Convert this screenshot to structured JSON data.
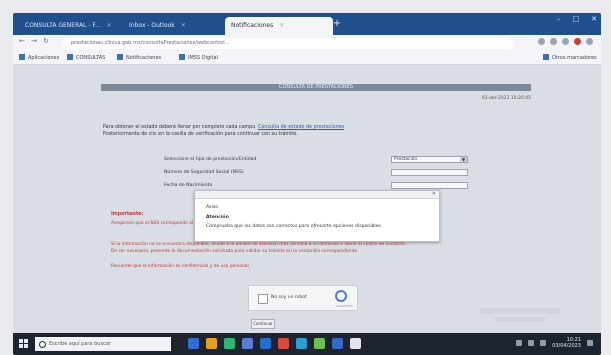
{
  "browser": {
    "tabs": [
      {
        "label": "CONSULTA GENERAL - F..."
      },
      {
        "label": "Inbox - Outlook"
      },
      {
        "label": "Notificaciones"
      }
    ],
    "new_tab": "+",
    "window_controls": [
      "–",
      "□",
      "✕"
    ],
    "address": "prestaciones.clinica.gob.mx/consultaPrestaciones/webcontrol...",
    "bookmarks": [
      "Aplicaciones",
      "CONSULTAS",
      "Notificaciones",
      "IMSS Digital",
      "Otros marcadores"
    ]
  },
  "page": {
    "header": "CONSULTA DE PRESTACIONES",
    "datetime": "03-abr-2023 10:20:45",
    "intro_line1": "Para obtener el estado deberá llenar por completo cada campo.",
    "intro_link": "Consulta de estado de prestaciones",
    "intro_line2": "Posteriormente de clic en la casilla de verificación para continuar con su trámite.",
    "fields": [
      {
        "label": "Seleccione el tipo de prestación/Entidad",
        "value": "Prestación",
        "has_arrow": true
      },
      {
        "label": "Número de Seguridad Social (NSS)",
        "value": "",
        "has_arrow": false
      },
      {
        "label": "Fecha de Nacimiento",
        "value": "",
        "has_arrow": false
      }
    ],
    "notice_title": "Importante:",
    "notice_lines": [
      "Asegúrese que el NSS corresponde al titular de la prestación y que los datos coincidan con los registrados en el sistema.",
      "Si la información no se encuentra disponible, acuda a la unidad de atención más cercana a su domicilio o llame al centro de contacto.",
      "De ser necesario, presente la documentación solicitada para validar su trámite en la ventanilla correspondiente.",
      "Recuerde que la información es confidencial y de uso personal."
    ],
    "captcha_label": "No soy un robot",
    "captcha_brand": "reCAPTCHA",
    "submit_label": "Continuar"
  },
  "dialog": {
    "close": "✕",
    "line1": "Aviso",
    "line2": "Atención",
    "line3": "Comprueba que los datos son correctos para ofrecerte opciones disponibles."
  },
  "taskbar": {
    "search_placeholder": "Escribe aquí para buscar",
    "clock_time": "10:21",
    "clock_date": "03/04/2023",
    "icon_colors": [
      "#2f6fd6",
      "#e3a21a",
      "#2bb673",
      "#5a7bd8",
      "#1d6fd1",
      "#d84a3a",
      "#2a9fd6",
      "#6cc04a",
      "#3469c9",
      "#e0e4ea"
    ]
  }
}
